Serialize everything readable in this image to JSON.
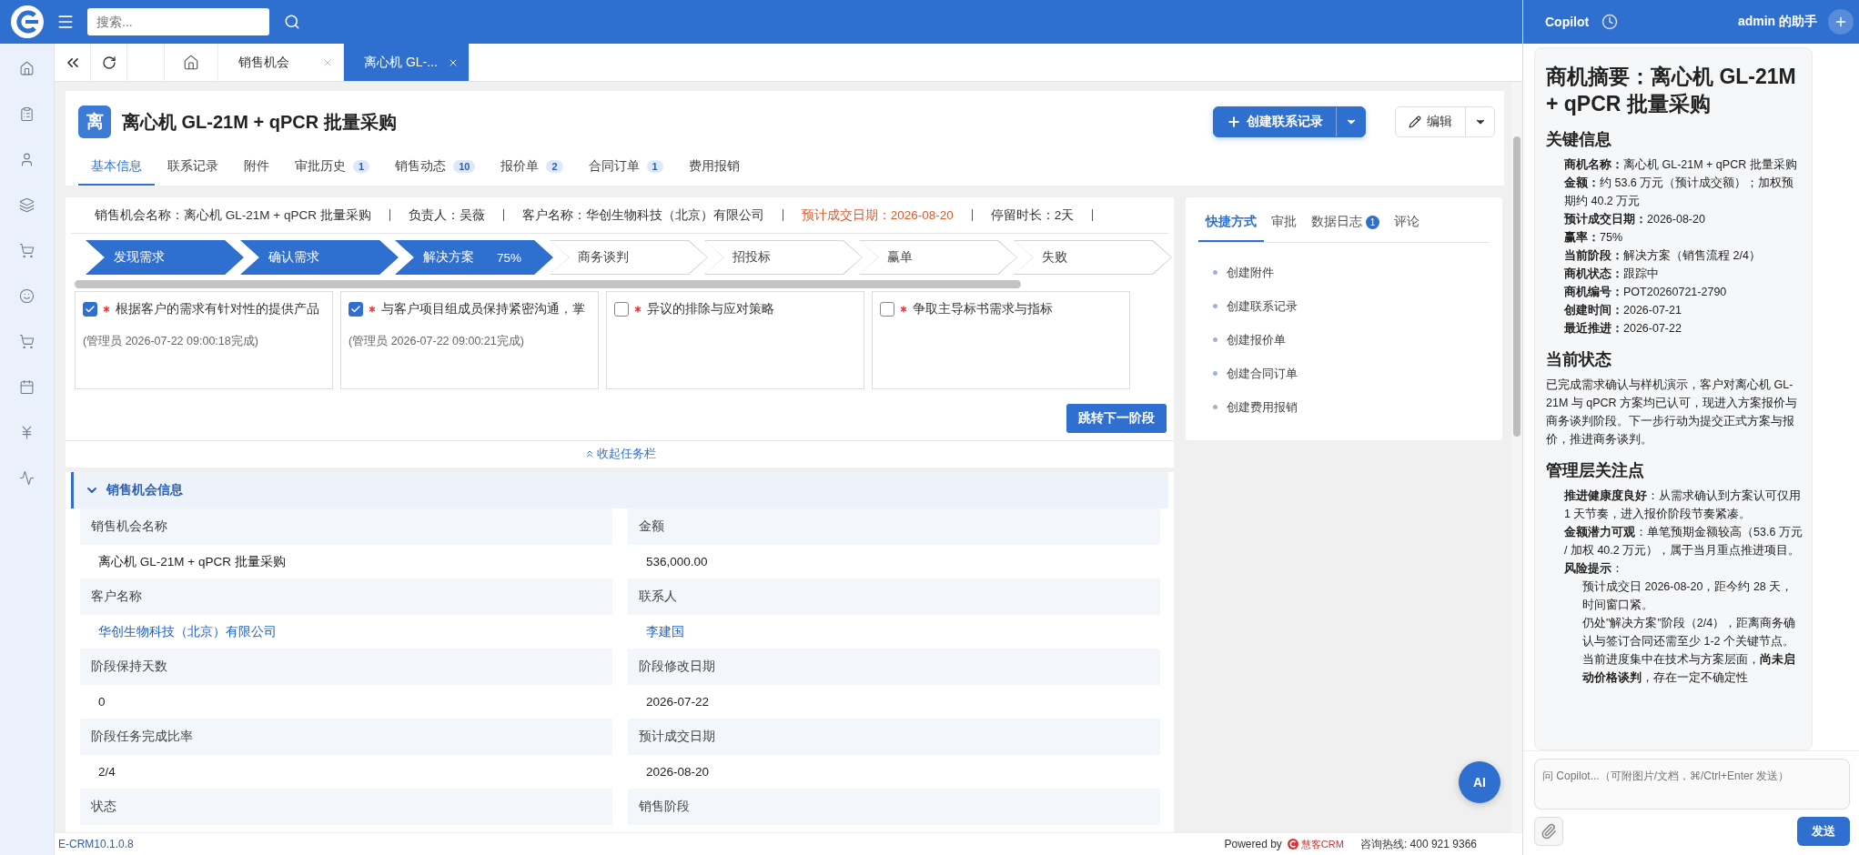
{
  "top_bar": {
    "search_placeholder": "搜索..."
  },
  "page_tabs": [
    {
      "label": "销售机会",
      "selected": false
    },
    {
      "label": "离心机 GL-...",
      "selected": true
    }
  ],
  "record": {
    "avatar": "离",
    "title": "离心机 GL-21M + qPCR 批量采购",
    "primary_action": "创建联系记录",
    "edit_action": "编辑"
  },
  "detail_tabs": [
    {
      "label": "基本信息",
      "selected": true
    },
    {
      "label": "联系记录",
      "selected": false
    },
    {
      "label": "附件",
      "selected": false
    },
    {
      "label": "审批历史",
      "badge": "1",
      "selected": false
    },
    {
      "label": "销售动态",
      "badge": "10",
      "selected": false
    },
    {
      "label": "报价单",
      "badge": "2",
      "selected": false
    },
    {
      "label": "合同订单",
      "badge": "1",
      "selected": false
    },
    {
      "label": "费用报销",
      "selected": false
    }
  ],
  "summary_line": [
    {
      "label": "销售机会名称：",
      "value": "离心机 GL-21M + qPCR 批量采购",
      "highlight": false
    },
    {
      "label": "负责人：",
      "value": "吴薇",
      "highlight": false
    },
    {
      "label": "客户名称：",
      "value": "华创生物科技（北京）有限公司",
      "highlight": false
    },
    {
      "label": "预计成交日期：",
      "value": "2026-08-20",
      "highlight": true
    },
    {
      "label": "停留时长：",
      "value": "2天",
      "highlight": false
    }
  ],
  "stages": [
    {
      "label": "发现需求",
      "done": true
    },
    {
      "label": "确认需求",
      "done": true
    },
    {
      "label": "解决方案",
      "done": true,
      "percent": "75%"
    },
    {
      "label": "商务谈判",
      "done": false
    },
    {
      "label": "招投标",
      "done": false
    },
    {
      "label": "赢单",
      "done": false
    },
    {
      "label": "失败",
      "done": false
    }
  ],
  "tasks": [
    {
      "label": "根据客户的需求有针对性的提供产品",
      "checked": true,
      "required": true,
      "note": "(管理员 2026-07-22 09:00:18完成)"
    },
    {
      "label": "与客户项目组成员保持紧密沟通，掌",
      "checked": true,
      "required": true,
      "note": "(管理员 2026-07-22 09:00:21完成)"
    },
    {
      "label": "异议的排除与应对策略",
      "checked": false,
      "required": true
    },
    {
      "label": "争取主导标书需求与指标",
      "checked": false,
      "required": true
    }
  ],
  "next_stage_button": "跳转下一阶段",
  "collapse_link": "收起任务栏",
  "info_section": {
    "title": "销售机会信息",
    "expanded": true,
    "fields": [
      {
        "label": "销售机会名称",
        "value": "离心机 GL-21M + qPCR 批量采购",
        "link": false
      },
      {
        "label": "金额",
        "value": "536,000.00",
        "link": false
      },
      {
        "label": "客户名称",
        "value": "华创生物科技（北京）有限公司",
        "link": true
      },
      {
        "label": "联系人",
        "value": "李建国",
        "link": true
      },
      {
        "label": "阶段保持天数",
        "value": "0",
        "link": false
      },
      {
        "label": "阶段修改日期",
        "value": "2026-07-22",
        "link": false
      },
      {
        "label": "阶段任务完成比率",
        "value": "2/4",
        "link": false
      },
      {
        "label": "预计成交日期",
        "value": "2026-08-20",
        "link": false
      },
      {
        "label": "状态"
      },
      {
        "label": "销售阶段"
      }
    ]
  },
  "side_tabs": [
    {
      "label": "快捷方式",
      "selected": true
    },
    {
      "label": "审批",
      "selected": false
    },
    {
      "label": "数据日志",
      "badge": "1",
      "selected": false
    },
    {
      "label": "评论",
      "selected": false
    }
  ],
  "shortcuts": [
    "创建附件",
    "创建联系记录",
    "创建报价单",
    "创建合同订单",
    "创建费用报销"
  ],
  "ai_button": "AI",
  "footer": {
    "version": "E-CRM10.1.0.8",
    "powered_by": "Powered by",
    "brand": "慧客CRM",
    "hotline": "咨询热线: 400 921 9366"
  },
  "copilot": {
    "title": "Copilot",
    "assistant": "admin 的助手",
    "heading": "商机摘要：离心机 GL-21M + qPCR 批量采购",
    "sections": [
      {
        "heading": "关键信息",
        "items": [
          {
            "text": "**商机名称：**离心机 GL-21M + qPCR 批量采购"
          },
          {
            "text": "**金额：**约 53.6 万元（预计成交额）；加权预期约 40.2 万元"
          },
          {
            "text": "**预计成交日期：**2026-08-20"
          },
          {
            "text": "**赢率：**75%"
          },
          {
            "text": "**当前阶段：**解决方案（销售流程 2/4）"
          },
          {
            "text": "**商机状态：**跟踪中"
          },
          {
            "text": "**商机编号：**POT20260721-2790"
          },
          {
            "text": "**创建时间：**2026-07-21"
          },
          {
            "text": "**最近推进：**2026-07-22"
          }
        ]
      },
      {
        "heading": "当前状态",
        "paragraph": "已完成需求确认与样机演示，客户对离心机 GL-21M 与 qPCR 方案均已认可，现进入方案报价与商务谈判阶段。下一步行动为提交正式方案与报价，推进商务谈判。"
      },
      {
        "heading": "管理层关注点",
        "items": [
          {
            "text": "**推进健康度良好**：从需求确认到方案认可仅用 1 天节奏，进入报价阶段节奏紧凑。"
          },
          {
            "text": "**金额潜力可观**：单笔预期金额较高（53.6 万元 / 加权 40.2 万元），属于当月重点推进项目。"
          },
          {
            "text": "**风险提示**：",
            "children": [
              {
                "text": "预计成交日 2026-08-20，距今约 28 天，时间窗口紧。"
              },
              {
                "text": "仍处\"解决方案\"阶段（2/4），距离商务确认与签订合同还需至少 1-2 个关键节点。"
              },
              {
                "text": "当前进度集中在技术与方案层面，**尚未启动价格谈判**，存在一定不确定性"
              }
            ]
          }
        ]
      }
    ],
    "input_placeholder": "问 Copilot...（可附图片/文档，⌘/Ctrl+Enter 发送）",
    "send_button": "发送"
  }
}
